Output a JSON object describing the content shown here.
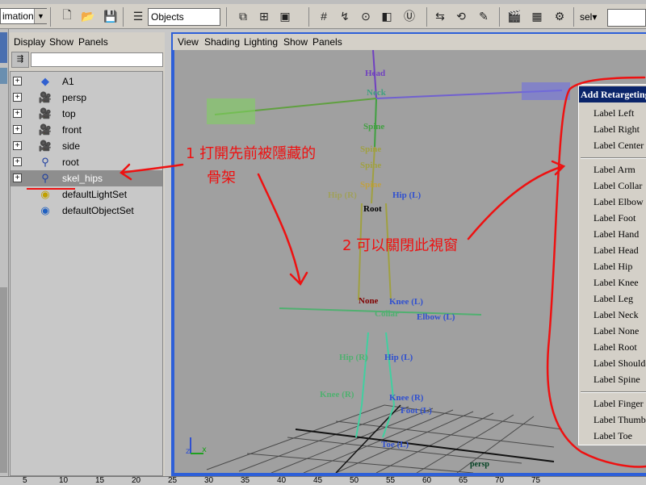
{
  "toolbar": {
    "mode_value": "imation",
    "objects_field": "Objects",
    "sel_label": "sel▾"
  },
  "outliner": {
    "menu": [
      "Display",
      "Show",
      "Panels"
    ],
    "items": [
      {
        "label": "A1",
        "icon": "plane-icon"
      },
      {
        "label": "persp",
        "icon": "camera-icon"
      },
      {
        "label": "top",
        "icon": "camera-icon"
      },
      {
        "label": "front",
        "icon": "camera-icon"
      },
      {
        "label": "side",
        "icon": "camera-icon"
      },
      {
        "label": "root",
        "icon": "joint-icon"
      },
      {
        "label": "skel_hips",
        "icon": "joint-icon",
        "selected": true
      },
      {
        "label": "defaultLightSet",
        "icon": "set-icon"
      },
      {
        "label": "defaultObjectSet",
        "icon": "set-icon"
      }
    ]
  },
  "viewport": {
    "menu": [
      "View",
      "Shading",
      "Lighting",
      "Show",
      "Panels"
    ],
    "camera_label": "persp",
    "joint_labels": [
      "Head",
      "Neck",
      "Spine",
      "Spine",
      "Spine",
      "Spine",
      "Root",
      "Hip (L)",
      "Hip (R)",
      "Knee (L)",
      "Foot (L)",
      "Toe (L)",
      "Knee (R)",
      "None",
      "Collar",
      "Elbow (L)",
      "Hip (L)",
      "Hip (R)",
      "Knee (R)"
    ]
  },
  "popup": {
    "title": "Add Retargeting",
    "items": [
      "Label Left",
      "Label Right",
      "Label Center",
      "---",
      "Label Arm",
      "Label Collar",
      "Label Elbow",
      "Label Foot",
      "Label Hand",
      "Label Head",
      "Label Hip",
      "Label Knee",
      "Label Leg",
      "Label Neck",
      "Label None",
      "Label Root",
      "Label Shoulder",
      "Label Spine",
      "---",
      "Label Finger",
      "Label Thumb",
      "Label Toe"
    ]
  },
  "annotations": {
    "note1_line1": "1 打開先前被隱藏的",
    "note1_line2": "骨架",
    "note2": "2 可以關閉此視窗"
  },
  "timeline": {
    "ticks": [
      "5",
      "10",
      "15",
      "20",
      "25",
      "30",
      "35",
      "40",
      "45",
      "50",
      "55",
      "60",
      "65",
      "70",
      "75"
    ]
  },
  "colors": {
    "viewport_bg": "#a0a0a0",
    "viewport_border": "#2d5fd8",
    "popup_title_bg": "#0a246a",
    "annotation": "#ee1111",
    "selection": "#8e8e8e"
  }
}
